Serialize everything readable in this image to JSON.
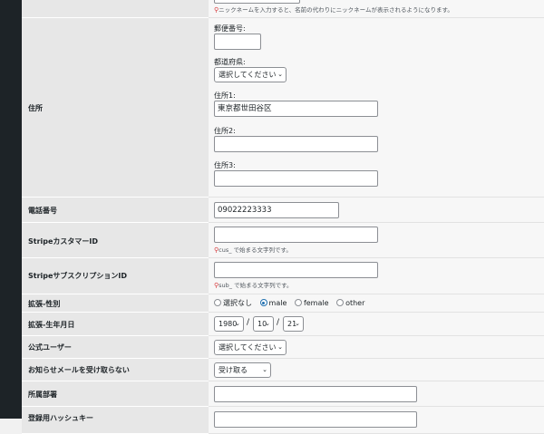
{
  "nickname": {
    "hint": "ニックネームを入力すると、名前の代わりにニックネームが表示されるようになります。"
  },
  "address": {
    "label": "住所",
    "postal_label": "郵便番号:",
    "postal_value": "",
    "pref_label": "都道府県:",
    "pref_value": "選択してください",
    "addr1_label": "住所1:",
    "addr1_value": "東京都世田谷区",
    "addr2_label": "住所2:",
    "addr2_value": "",
    "addr3_label": "住所3:",
    "addr3_value": ""
  },
  "phone": {
    "label": "電話番号",
    "value": "09022223333"
  },
  "stripe_customer": {
    "label": "StripeカスタマーID",
    "value": "",
    "hint": "cus_ で始まる文字列です。"
  },
  "stripe_subscription": {
    "label": "StripeサブスクリプションID",
    "value": "",
    "hint": "sub_ で始まる文字列です。"
  },
  "gender": {
    "label": "拡張-性別",
    "options": [
      "選択なし",
      "male",
      "female",
      "other"
    ],
    "selected": "male"
  },
  "birthdate": {
    "label": "拡張-生年月日",
    "year": "1980",
    "month": "10",
    "day": "21",
    "separator": "/"
  },
  "official_user": {
    "label": "公式ユーザー",
    "value": "選択してください"
  },
  "mail_optout": {
    "label": "お知らせメールを受け取らない",
    "value": "受け取る"
  },
  "department": {
    "label": "所属部署",
    "value": ""
  },
  "password_hash": {
    "label": "登録用ハッシュキー",
    "value": ""
  },
  "icons": {
    "hint_pin": "pin-icon",
    "chevron": "chevron-down-icon"
  }
}
